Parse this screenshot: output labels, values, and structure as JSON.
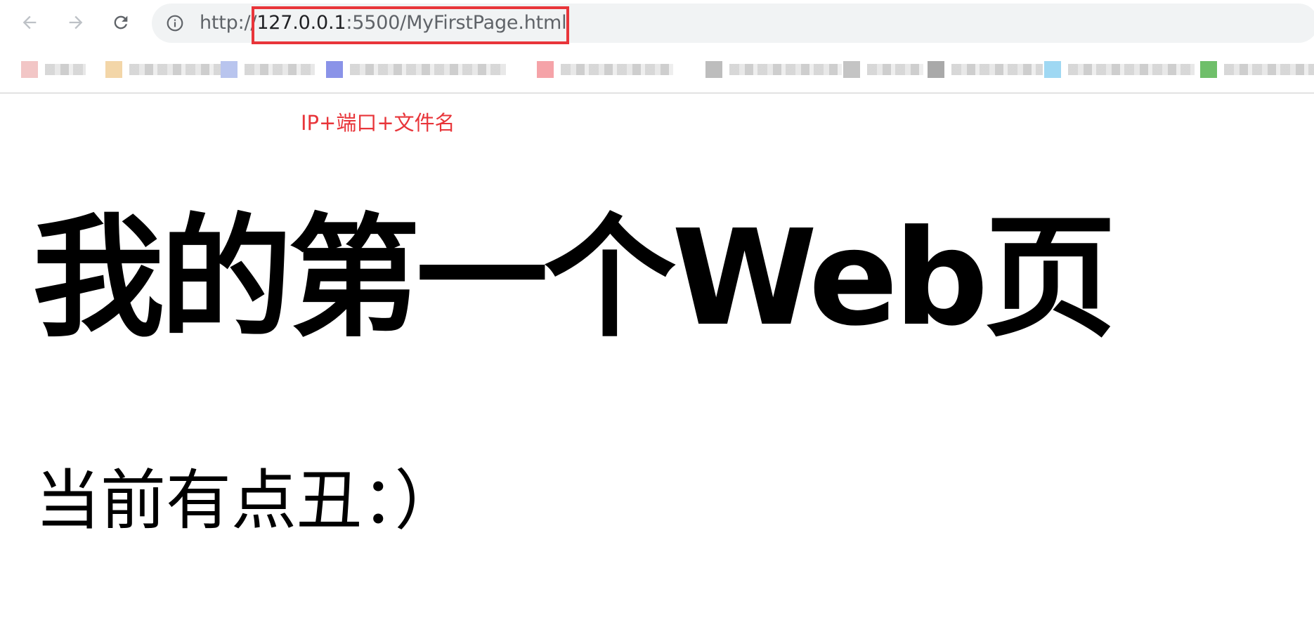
{
  "browser": {
    "url_scheme": "http://",
    "url_host": "127.0.0.1",
    "url_path": ":5500/MyFirstPage.html"
  },
  "annotation": {
    "label": "IP+端口+文件名",
    "color": "#e8353a"
  },
  "bookmarks": [
    {
      "fav_color": "#f2c6c6"
    },
    {
      "fav_color": "#f3d6a8"
    },
    {
      "fav_color": "#b9c5ee"
    },
    {
      "fav_color": "#8a93e8"
    },
    {
      "fav_color": "#f5a3a8"
    },
    {
      "fav_color": "#bdbdbd"
    },
    {
      "fav_color": "#c4c4c4"
    },
    {
      "fav_color": "#a9a9a9"
    },
    {
      "fav_color": "#9fd8f3"
    },
    {
      "fav_color": "#6fbf6a"
    }
  ],
  "page": {
    "heading": "我的第一个Web页",
    "paragraph": "当前有点丑：）"
  },
  "icons": {
    "back": "arrow-left-icon",
    "forward": "arrow-right-icon",
    "reload": "reload-icon",
    "info": "info-circle-icon"
  }
}
